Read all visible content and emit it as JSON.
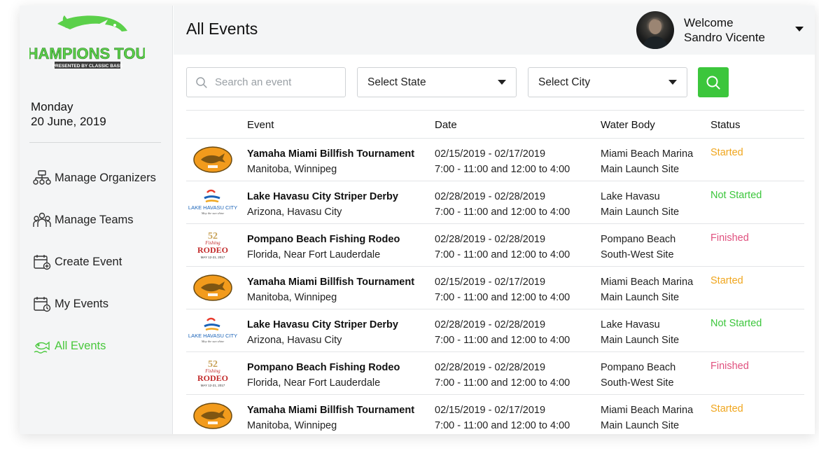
{
  "app": {
    "logo_title": "CHAMPIONS TOUR",
    "logo_subtitle": "PRESENTED BY CLASSIC BASS",
    "brand_green": "#49c83c"
  },
  "date": {
    "weekday": "Monday",
    "full": "20 June, 2019"
  },
  "sidebar": {
    "items": [
      {
        "label": "Manage Organizers",
        "icon": "organizers-icon",
        "active": false
      },
      {
        "label": "Manage Teams",
        "icon": "teams-icon",
        "active": false
      },
      {
        "label": "Create Event",
        "icon": "calendar-add-icon",
        "active": false
      },
      {
        "label": "My Events",
        "icon": "calendar-clock-icon",
        "active": false
      },
      {
        "label": "All Events",
        "icon": "fish-icon",
        "active": true
      }
    ]
  },
  "header": {
    "title": "All Events",
    "welcome": "Welcome",
    "user_name": "Sandro Vicente"
  },
  "filters": {
    "search_placeholder": "Search an event",
    "state_label": "Select State",
    "city_label": "Select City"
  },
  "table": {
    "columns": [
      "Event",
      "Date",
      "Water Body",
      "Status"
    ],
    "rows": [
      {
        "logo": "billfish",
        "name": "Yamaha Miami Billfish Tournament",
        "location": "Manitoba, Winnipeg",
        "dates": "02/15/2019 - 02/17/2019",
        "times": "7:00 - 11:00 and 12:00 to 4:00",
        "water": "Miami Beach Marina",
        "site": "Main Launch Site",
        "status": "Started",
        "status_color": "#f0a61e"
      },
      {
        "logo": "havasu",
        "name": "Lake Havasu City Striper Derby",
        "location": "Arizona, Havasu City",
        "dates": "02/28/2019 - 02/28/2019",
        "times": "7:00 - 11:00 and 12:00 to 4:00",
        "water": "Lake Havasu",
        "site": "Main Launch Site",
        "status": "Not Started",
        "status_color": "#3cc63c"
      },
      {
        "logo": "rodeo",
        "name": "Pompano Beach Fishing Rodeo",
        "location": "Florida, Near Fort Lauderdale",
        "dates": "02/28/2019 - 02/28/2019",
        "times": "7:00 - 11:00 and 12:00 to 4:00",
        "water": "Pompano Beach",
        "site": "South-West Site",
        "status": "Finished",
        "status_color": "#e0507e"
      },
      {
        "logo": "billfish",
        "name": "Yamaha Miami Billfish Tournament",
        "location": "Manitoba, Winnipeg",
        "dates": "02/15/2019 - 02/17/2019",
        "times": "7:00 - 11:00 and 12:00 to 4:00",
        "water": "Miami Beach Marina",
        "site": "Main Launch Site",
        "status": "Started",
        "status_color": "#f0a61e"
      },
      {
        "logo": "havasu",
        "name": "Lake Havasu City Striper Derby",
        "location": "Arizona, Havasu City",
        "dates": "02/28/2019 - 02/28/2019",
        "times": "7:00 - 11:00 and 12:00 to 4:00",
        "water": "Lake Havasu",
        "site": "Main Launch Site",
        "status": "Not Started",
        "status_color": "#3cc63c"
      },
      {
        "logo": "rodeo",
        "name": "Pompano Beach Fishing Rodeo",
        "location": "Florida, Near Fort Lauderdale",
        "dates": "02/28/2019 - 02/28/2019",
        "times": "7:00 - 11:00 and 12:00 to 4:00",
        "water": "Pompano Beach",
        "site": "South-West Site",
        "status": "Finished",
        "status_color": "#e0507e"
      },
      {
        "logo": "billfish",
        "name": "Yamaha Miami Billfish Tournament",
        "location": "Manitoba, Winnipeg",
        "dates": "02/15/2019 - 02/17/2019",
        "times": "7:00 - 11:00 and 12:00 to 4:00",
        "water": "Miami Beach Marina",
        "site": "Main Launch Site",
        "status": "Started",
        "status_color": "#f0a61e"
      }
    ]
  }
}
